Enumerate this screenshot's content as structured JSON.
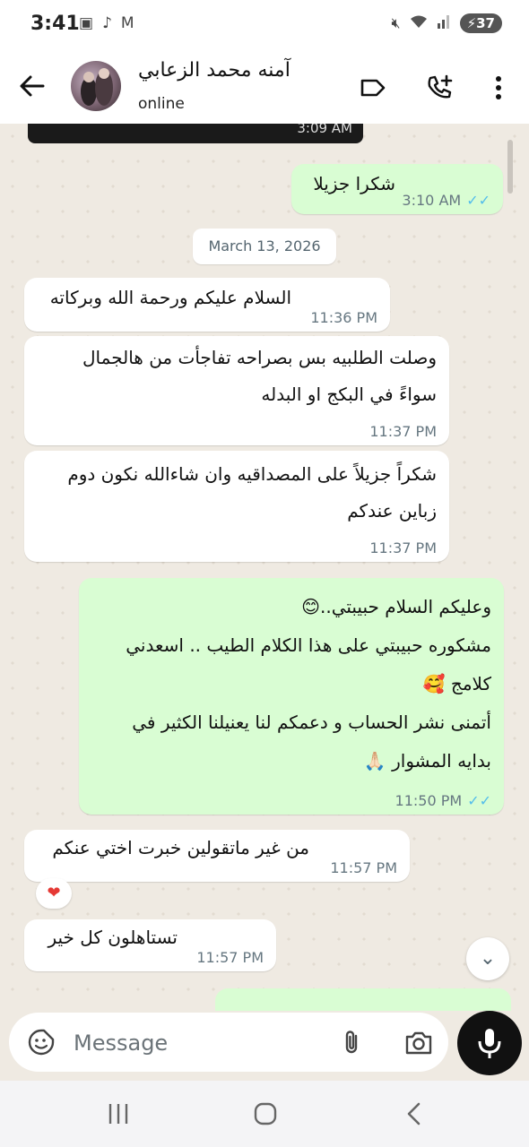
{
  "status": {
    "time": "3:41",
    "battery": "37"
  },
  "header": {
    "contact_name": "آمنه محمد الزعابي",
    "contact_status": "online"
  },
  "chat": {
    "previous_image_time": "3:09 AM",
    "date_chip": "March 13, 2026",
    "messages": [
      {
        "direction": "out",
        "lines": [
          "شكرا جزيلا"
        ],
        "time": "3:10 AM",
        "read": true
      },
      {
        "direction": "in",
        "lines": [
          "السلام عليكم ورحمة الله وبركاته"
        ],
        "time": "11:36 PM"
      },
      {
        "direction": "in",
        "lines": [
          "وصلت الطلبيه بس بصراحه تفاجأت من هالجمال",
          "سواءً في البكج او البدله"
        ],
        "time": "11:37 PM"
      },
      {
        "direction": "in",
        "lines": [
          "شكراً جزيلاً على المصداقيه وان شاءالله نكون دوم",
          "زباين عندكم"
        ],
        "time": "11:37 PM"
      },
      {
        "direction": "out",
        "lines": [
          "وعليكم السلام حبيبتي..😊",
          "مشكوره حبيبتي على هذا الكلام الطيب .. اسعدني",
          "كلامج 🥰",
          "أتمنى نشر الحساب و دعمكم لنا يعنيلنا الكثير في",
          "بدايه المشوار 🙏🏻"
        ],
        "time": "11:50 PM",
        "read": true
      },
      {
        "direction": "in",
        "lines": [
          "من غير ماتقولين خبرت اختي عنكم"
        ],
        "time": "11:57 PM",
        "reaction": "❤"
      },
      {
        "direction": "in",
        "lines": [
          "تستاهلون كل خير"
        ],
        "time": "11:57 PM"
      }
    ]
  },
  "composer": {
    "placeholder": "Message"
  },
  "colors": {
    "incoming_bubble": "#ffffff",
    "outgoing_bubble": "#d9fdd3",
    "read_ticks": "#53bdeb",
    "chat_bg": "#efeae2"
  }
}
